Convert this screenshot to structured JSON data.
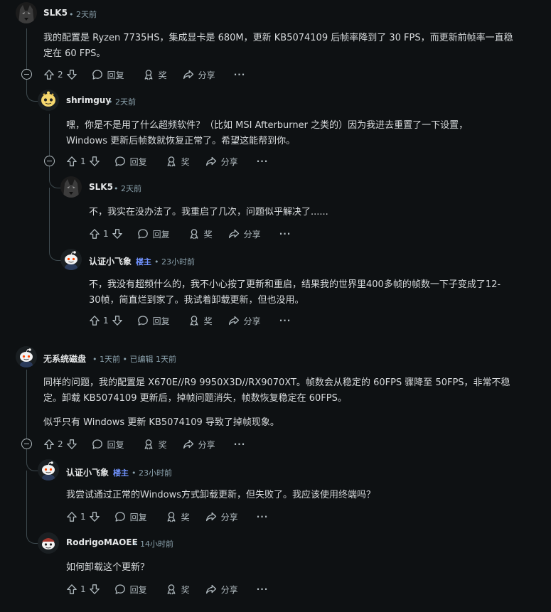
{
  "comments": [
    {
      "author": "SLK5",
      "meta": "• 2天前",
      "lines": [
        "我的配置是 Ryzen 7735HS，集成显卡是 680M，更新 KB5074109 后帧率降到了 30 FPS，而更新前帧率一直稳",
        "定在 60 FPS。"
      ],
      "votes": "2",
      "reply": "回复",
      "award": "奖",
      "share": "分享",
      "more": "···",
      "avatar_icon": "wolf-avatar-icon"
    },
    {
      "author": "shrimguy",
      "meta": "• 2天前",
      "lines": [
        "嘿，你是不是用了什么超频软件？（比如 MSI Afterburner 之类的）因为我进去重置了一下设置，",
        "Windows 更新后帧数就恢复正常了。希望这能帮到你。"
      ],
      "votes": "1",
      "reply": "回复",
      "award": "奖",
      "share": "分享",
      "more": "···",
      "avatar_icon": "yellow-snoo-avatar-icon"
    },
    {
      "author": "SLK5",
      "meta": "• 2天前",
      "lines": [
        "不，我实在没办法了。我重启了几次，问题似乎解决了......"
      ],
      "votes": "1",
      "reply": "回复",
      "award": "奖",
      "share": "分享",
      "more": "···",
      "avatar_icon": "wolf-avatar-icon"
    },
    {
      "author": "认证小飞象",
      "op": "楼主",
      "meta": "• 23小时前",
      "lines": [
        "不，我没有超频什么的，我不小心按了更新和重启，结果我的世界里400多帧的帧数一下子变成了12-",
        "30帧，简直烂到家了。我试着卸载更新，但也没用。"
      ],
      "votes": "1",
      "reply": "回复",
      "award": "奖",
      "share": "分享",
      "more": "···",
      "avatar_icon": "snoo-avatar-icon"
    },
    {
      "author": "无系统磁盘",
      "meta": "• 1天前 • 已编辑 1天前",
      "lines": [
        "同样的问题，我的配置是 X670E//R9 9950X3D//RX9070XT。帧数会从稳定的 60FPS 骤降至 50FPS，非常不稳",
        "定。卸载 KB5074109 更新后，掉帧问题消失，帧数恢复稳定在 60FPS。",
        "",
        "似乎只有 Windows 更新 KB5074109 导致了掉帧现象。"
      ],
      "votes": "2",
      "reply": "回复",
      "award": "奖",
      "share": "分享",
      "more": "···",
      "avatar_icon": "snoo-avatar-icon"
    },
    {
      "author": "认证小飞象",
      "op": "楼主",
      "meta": "• 23小时前",
      "lines": [
        "我尝试通过正常的Windows方式卸载更新，但失败了。我应该使用终端吗？"
      ],
      "votes": "1",
      "reply": "回复",
      "award": "奖",
      "share": "分享",
      "more": "···",
      "avatar_icon": "snoo-avatar-icon"
    },
    {
      "author": "RodrigoMAOEE",
      "meta": "• 14小时前",
      "lines": [
        "如何卸载这个更新？"
      ],
      "votes": "1",
      "reply": "回复",
      "award": "奖",
      "share": "分享",
      "more": "···",
      "avatar_icon": "snoo-red-hat-avatar-icon"
    }
  ],
  "colors": {
    "background": "#0e1113",
    "text": "#d7dadc",
    "meta": "#8ba2ad",
    "op_badge": "#7193ff",
    "thread_line": "#3e4a4f"
  }
}
